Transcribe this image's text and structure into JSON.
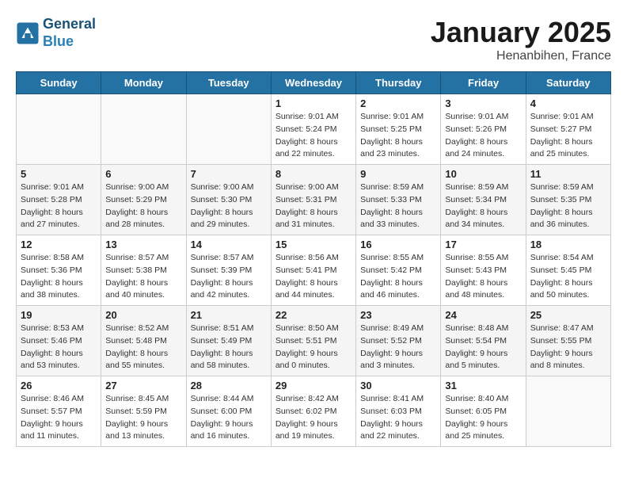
{
  "header": {
    "logo_line1": "General",
    "logo_line2": "Blue",
    "month": "January 2025",
    "location": "Henanbihen, France"
  },
  "weekdays": [
    "Sunday",
    "Monday",
    "Tuesday",
    "Wednesday",
    "Thursday",
    "Friday",
    "Saturday"
  ],
  "weeks": [
    [
      {
        "day": "",
        "info": ""
      },
      {
        "day": "",
        "info": ""
      },
      {
        "day": "",
        "info": ""
      },
      {
        "day": "1",
        "info": "Sunrise: 9:01 AM\nSunset: 5:24 PM\nDaylight: 8 hours\nand 22 minutes."
      },
      {
        "day": "2",
        "info": "Sunrise: 9:01 AM\nSunset: 5:25 PM\nDaylight: 8 hours\nand 23 minutes."
      },
      {
        "day": "3",
        "info": "Sunrise: 9:01 AM\nSunset: 5:26 PM\nDaylight: 8 hours\nand 24 minutes."
      },
      {
        "day": "4",
        "info": "Sunrise: 9:01 AM\nSunset: 5:27 PM\nDaylight: 8 hours\nand 25 minutes."
      }
    ],
    [
      {
        "day": "5",
        "info": "Sunrise: 9:01 AM\nSunset: 5:28 PM\nDaylight: 8 hours\nand 27 minutes."
      },
      {
        "day": "6",
        "info": "Sunrise: 9:00 AM\nSunset: 5:29 PM\nDaylight: 8 hours\nand 28 minutes."
      },
      {
        "day": "7",
        "info": "Sunrise: 9:00 AM\nSunset: 5:30 PM\nDaylight: 8 hours\nand 29 minutes."
      },
      {
        "day": "8",
        "info": "Sunrise: 9:00 AM\nSunset: 5:31 PM\nDaylight: 8 hours\nand 31 minutes."
      },
      {
        "day": "9",
        "info": "Sunrise: 8:59 AM\nSunset: 5:33 PM\nDaylight: 8 hours\nand 33 minutes."
      },
      {
        "day": "10",
        "info": "Sunrise: 8:59 AM\nSunset: 5:34 PM\nDaylight: 8 hours\nand 34 minutes."
      },
      {
        "day": "11",
        "info": "Sunrise: 8:59 AM\nSunset: 5:35 PM\nDaylight: 8 hours\nand 36 minutes."
      }
    ],
    [
      {
        "day": "12",
        "info": "Sunrise: 8:58 AM\nSunset: 5:36 PM\nDaylight: 8 hours\nand 38 minutes."
      },
      {
        "day": "13",
        "info": "Sunrise: 8:57 AM\nSunset: 5:38 PM\nDaylight: 8 hours\nand 40 minutes."
      },
      {
        "day": "14",
        "info": "Sunrise: 8:57 AM\nSunset: 5:39 PM\nDaylight: 8 hours\nand 42 minutes."
      },
      {
        "day": "15",
        "info": "Sunrise: 8:56 AM\nSunset: 5:41 PM\nDaylight: 8 hours\nand 44 minutes."
      },
      {
        "day": "16",
        "info": "Sunrise: 8:55 AM\nSunset: 5:42 PM\nDaylight: 8 hours\nand 46 minutes."
      },
      {
        "day": "17",
        "info": "Sunrise: 8:55 AM\nSunset: 5:43 PM\nDaylight: 8 hours\nand 48 minutes."
      },
      {
        "day": "18",
        "info": "Sunrise: 8:54 AM\nSunset: 5:45 PM\nDaylight: 8 hours\nand 50 minutes."
      }
    ],
    [
      {
        "day": "19",
        "info": "Sunrise: 8:53 AM\nSunset: 5:46 PM\nDaylight: 8 hours\nand 53 minutes."
      },
      {
        "day": "20",
        "info": "Sunrise: 8:52 AM\nSunset: 5:48 PM\nDaylight: 8 hours\nand 55 minutes."
      },
      {
        "day": "21",
        "info": "Sunrise: 8:51 AM\nSunset: 5:49 PM\nDaylight: 8 hours\nand 58 minutes."
      },
      {
        "day": "22",
        "info": "Sunrise: 8:50 AM\nSunset: 5:51 PM\nDaylight: 9 hours\nand 0 minutes."
      },
      {
        "day": "23",
        "info": "Sunrise: 8:49 AM\nSunset: 5:52 PM\nDaylight: 9 hours\nand 3 minutes."
      },
      {
        "day": "24",
        "info": "Sunrise: 8:48 AM\nSunset: 5:54 PM\nDaylight: 9 hours\nand 5 minutes."
      },
      {
        "day": "25",
        "info": "Sunrise: 8:47 AM\nSunset: 5:55 PM\nDaylight: 9 hours\nand 8 minutes."
      }
    ],
    [
      {
        "day": "26",
        "info": "Sunrise: 8:46 AM\nSunset: 5:57 PM\nDaylight: 9 hours\nand 11 minutes."
      },
      {
        "day": "27",
        "info": "Sunrise: 8:45 AM\nSunset: 5:59 PM\nDaylight: 9 hours\nand 13 minutes."
      },
      {
        "day": "28",
        "info": "Sunrise: 8:44 AM\nSunset: 6:00 PM\nDaylight: 9 hours\nand 16 minutes."
      },
      {
        "day": "29",
        "info": "Sunrise: 8:42 AM\nSunset: 6:02 PM\nDaylight: 9 hours\nand 19 minutes."
      },
      {
        "day": "30",
        "info": "Sunrise: 8:41 AM\nSunset: 6:03 PM\nDaylight: 9 hours\nand 22 minutes."
      },
      {
        "day": "31",
        "info": "Sunrise: 8:40 AM\nSunset: 6:05 PM\nDaylight: 9 hours\nand 25 minutes."
      },
      {
        "day": "",
        "info": ""
      }
    ]
  ]
}
